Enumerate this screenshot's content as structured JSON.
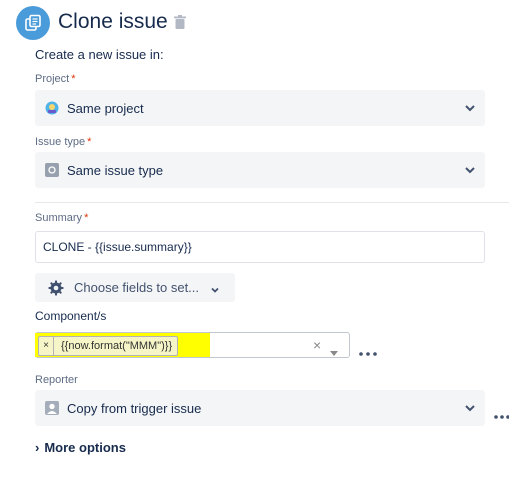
{
  "header": {
    "title": "Clone issue",
    "icon": "clone-icon"
  },
  "intro": "Create a new issue in:",
  "project": {
    "label": "Project",
    "required": "*",
    "value": "Same project",
    "icon": "project-avatar-icon"
  },
  "issue_type": {
    "label": "Issue type",
    "required": "*",
    "value": "Same issue type",
    "icon": "issue-type-icon"
  },
  "summary": {
    "label": "Summary",
    "required": "*",
    "value": "CLONE - {{issue.summary}}"
  },
  "choose_fields": {
    "label": "Choose fields to set...",
    "icon": "gear-icon"
  },
  "components": {
    "label": "Component/s",
    "tag_remove": "×",
    "tag": "{{now.format(\"MMM\")}}",
    "clear": "×"
  },
  "reporter": {
    "label": "Reporter",
    "value": "Copy from trigger issue",
    "icon": "user-avatar-icon"
  },
  "more_options": {
    "label": "More options",
    "toggle": "›"
  },
  "colors": {
    "accent": "#4a9bd9",
    "highlight": "#ffff00",
    "required": "#de350b"
  }
}
